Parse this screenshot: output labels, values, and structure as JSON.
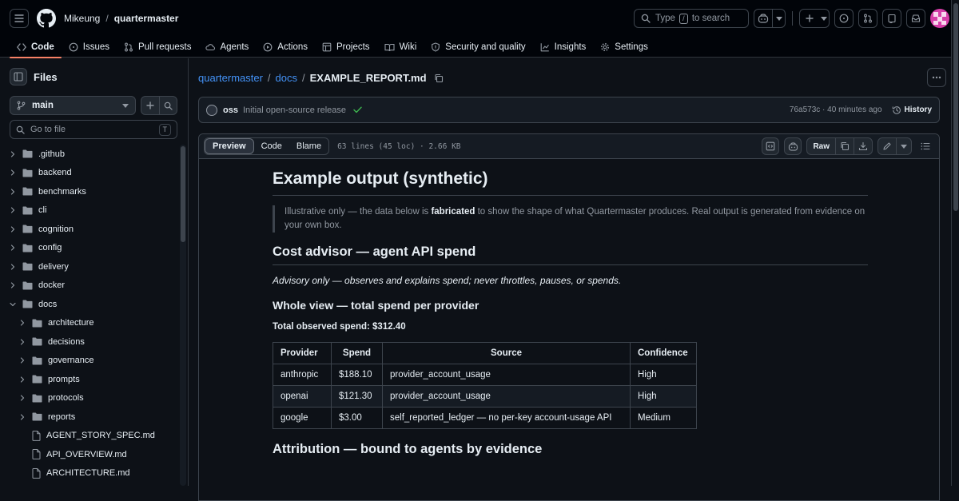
{
  "header": {
    "owner": "Mikeung",
    "repo": "quartermaster",
    "search_prefix": "Type",
    "search_key": "/",
    "search_suffix": "to search"
  },
  "tabs": [
    {
      "label": "Code",
      "icon": "code-icon"
    },
    {
      "label": "Issues",
      "icon": "issue-icon"
    },
    {
      "label": "Pull requests",
      "icon": "pull-request-icon"
    },
    {
      "label": "Agents",
      "icon": "agents-icon"
    },
    {
      "label": "Actions",
      "icon": "play-icon"
    },
    {
      "label": "Projects",
      "icon": "table-icon"
    },
    {
      "label": "Wiki",
      "icon": "book-icon"
    },
    {
      "label": "Security and quality",
      "icon": "shield-icon"
    },
    {
      "label": "Insights",
      "icon": "graph-icon"
    },
    {
      "label": "Settings",
      "icon": "gear-icon"
    }
  ],
  "sidebar": {
    "title": "Files",
    "branch": "main",
    "goto_placeholder": "Go to file",
    "goto_key": "T",
    "tree": [
      {
        "label": ".github",
        "type": "folder",
        "depth": 0,
        "expanded": false
      },
      {
        "label": "backend",
        "type": "folder",
        "depth": 0,
        "expanded": false
      },
      {
        "label": "benchmarks",
        "type": "folder",
        "depth": 0,
        "expanded": false
      },
      {
        "label": "cli",
        "type": "folder",
        "depth": 0,
        "expanded": false
      },
      {
        "label": "cognition",
        "type": "folder",
        "depth": 0,
        "expanded": false
      },
      {
        "label": "config",
        "type": "folder",
        "depth": 0,
        "expanded": false
      },
      {
        "label": "delivery",
        "type": "folder",
        "depth": 0,
        "expanded": false
      },
      {
        "label": "docker",
        "type": "folder",
        "depth": 0,
        "expanded": false
      },
      {
        "label": "docs",
        "type": "folder",
        "depth": 0,
        "expanded": true
      },
      {
        "label": "architecture",
        "type": "folder",
        "depth": 1,
        "expanded": false
      },
      {
        "label": "decisions",
        "type": "folder",
        "depth": 1,
        "expanded": false
      },
      {
        "label": "governance",
        "type": "folder",
        "depth": 1,
        "expanded": false
      },
      {
        "label": "prompts",
        "type": "folder",
        "depth": 1,
        "expanded": false
      },
      {
        "label": "protocols",
        "type": "folder",
        "depth": 1,
        "expanded": false
      },
      {
        "label": "reports",
        "type": "folder",
        "depth": 1,
        "expanded": false
      },
      {
        "label": "AGENT_STORY_SPEC.md",
        "type": "file",
        "depth": 1
      },
      {
        "label": "API_OVERVIEW.md",
        "type": "file",
        "depth": 1
      },
      {
        "label": "ARCHITECTURE.md",
        "type": "file",
        "depth": 1
      }
    ]
  },
  "breadcrumb": {
    "repo": "quartermaster",
    "dir": "docs",
    "file": "EXAMPLE_REPORT.md"
  },
  "commit": {
    "author": "oss",
    "message": "Initial open-source release",
    "sha_time": "76a573c · 40 minutes ago",
    "history_label": "History"
  },
  "file_header": {
    "views": [
      "Preview",
      "Code",
      "Blame"
    ],
    "active_view": "Preview",
    "meta": "63 lines (45 loc) · 2.66 KB",
    "raw_label": "Raw"
  },
  "content": {
    "h1": "Example output (synthetic)",
    "quote_pre": "Illustrative only — the data below is ",
    "quote_bold": "fabricated",
    "quote_post": " to show the shape of what Quartermaster produces. Real output is generated from evidence on your own box.",
    "h2_cost": "Cost advisor — agent API spend",
    "advisory": "Advisory only — observes and explains spend; never throttles, pauses, or spends.",
    "h3_whole": "Whole view — total spend per provider",
    "total": "Total observed spend: $312.40",
    "table": {
      "headers": [
        "Provider",
        "Spend",
        "Source",
        "Confidence"
      ],
      "rows": [
        [
          "anthropic",
          "$188.10",
          "provider_account_usage",
          "High"
        ],
        [
          "openai",
          "$121.30",
          "provider_account_usage",
          "High"
        ],
        [
          "google",
          "$3.00",
          "self_reported_ledger — no per-key account-usage API",
          "Medium"
        ]
      ]
    },
    "h2_attrib": "Attribution — bound to agents by evidence"
  }
}
